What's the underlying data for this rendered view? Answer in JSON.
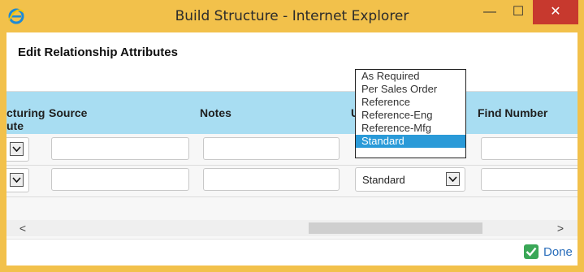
{
  "window": {
    "title": "Build Structure - Internet Explorer",
    "buttons": {
      "minimize": "—",
      "maximize": "☐",
      "close": "✕"
    }
  },
  "page": {
    "heading": "Edit Relationship Attributes"
  },
  "grid": {
    "columns": [
      {
        "label": "cturing\nute",
        "key": "manufacturing_route"
      },
      {
        "label": "Source",
        "key": "source"
      },
      {
        "label": "Notes",
        "key": "notes"
      },
      {
        "label": "U",
        "key": "usage"
      },
      {
        "label": "Find Number",
        "key": "find_number"
      }
    ],
    "rows": [
      {
        "usage": "",
        "source": "",
        "notes": "",
        "find_number": ""
      },
      {
        "usage": "Standard",
        "source": "",
        "notes": "",
        "find_number": ""
      }
    ],
    "scroll": {
      "left": "<",
      "right": ">"
    }
  },
  "dropdown": {
    "options": [
      "As Required",
      "Per Sales Order",
      "Reference",
      "Reference-Eng",
      "Reference-Mfg",
      "Standard"
    ],
    "selected": "Standard"
  },
  "footer": {
    "done_label": "Done"
  },
  "colors": {
    "frame": "#f2c14b",
    "header": "#a8ddf2",
    "selected": "#2a9ad8",
    "close": "#c7392e",
    "done": "#2a6ebb"
  }
}
